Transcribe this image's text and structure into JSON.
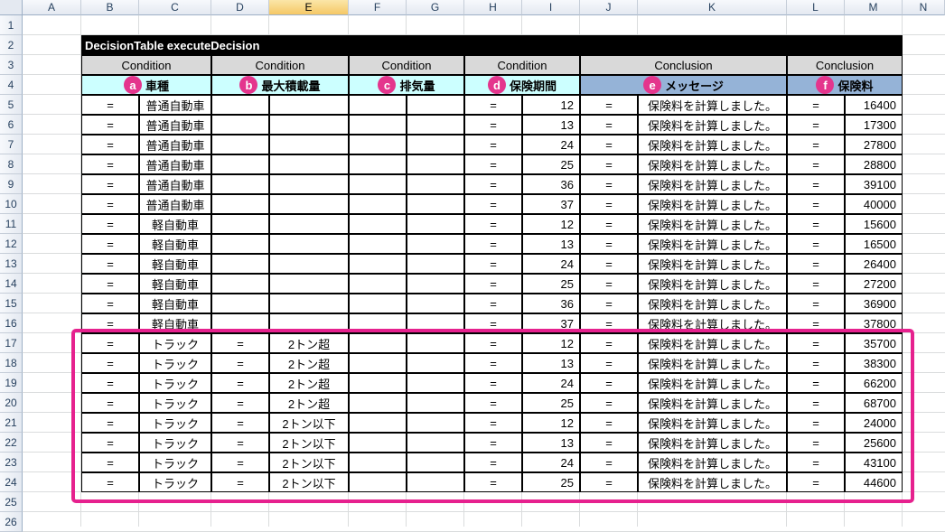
{
  "columns": [
    "A",
    "B",
    "C",
    "D",
    "E",
    "F",
    "G",
    "H",
    "I",
    "J",
    "K",
    "L",
    "M",
    "N"
  ],
  "selected_column": "E",
  "rows": [
    "1",
    "2",
    "3",
    "4",
    "5",
    "6",
    "7",
    "8",
    "9",
    "10",
    "11",
    "12",
    "13",
    "14",
    "15",
    "16",
    "17",
    "18",
    "19",
    "20",
    "21",
    "22",
    "23",
    "24",
    "25",
    "26"
  ],
  "table_title": "DecisionTable executeDecision",
  "group_headers": [
    "Condition",
    "Condition",
    "Condition",
    "Condition",
    "Conclusion",
    "Conclusion"
  ],
  "field_headers": [
    {
      "badge": "a",
      "label": "車種"
    },
    {
      "badge": "b",
      "label": "最大積載量"
    },
    {
      "badge": "c",
      "label": "排気量"
    },
    {
      "badge": "d",
      "label": "保険期間"
    },
    {
      "badge": "e",
      "label": "メッセージ"
    },
    {
      "badge": "f",
      "label": "保険料"
    }
  ],
  "data_rows": [
    [
      "=",
      "普通自動車",
      "",
      "",
      "",
      "",
      "=",
      "12",
      "=",
      "保険料を計算しました。",
      "=",
      "16400"
    ],
    [
      "=",
      "普通自動車",
      "",
      "",
      "",
      "",
      "=",
      "13",
      "=",
      "保険料を計算しました。",
      "=",
      "17300"
    ],
    [
      "=",
      "普通自動車",
      "",
      "",
      "",
      "",
      "=",
      "24",
      "=",
      "保険料を計算しました。",
      "=",
      "27800"
    ],
    [
      "=",
      "普通自動車",
      "",
      "",
      "",
      "",
      "=",
      "25",
      "=",
      "保険料を計算しました。",
      "=",
      "28800"
    ],
    [
      "=",
      "普通自動車",
      "",
      "",
      "",
      "",
      "=",
      "36",
      "=",
      "保険料を計算しました。",
      "=",
      "39100"
    ],
    [
      "=",
      "普通自動車",
      "",
      "",
      "",
      "",
      "=",
      "37",
      "=",
      "保険料を計算しました。",
      "=",
      "40000"
    ],
    [
      "=",
      "軽自動車",
      "",
      "",
      "",
      "",
      "=",
      "12",
      "=",
      "保険料を計算しました。",
      "=",
      "15600"
    ],
    [
      "=",
      "軽自動車",
      "",
      "",
      "",
      "",
      "=",
      "13",
      "=",
      "保険料を計算しました。",
      "=",
      "16500"
    ],
    [
      "=",
      "軽自動車",
      "",
      "",
      "",
      "",
      "=",
      "24",
      "=",
      "保険料を計算しました。",
      "=",
      "26400"
    ],
    [
      "=",
      "軽自動車",
      "",
      "",
      "",
      "",
      "=",
      "25",
      "=",
      "保険料を計算しました。",
      "=",
      "27200"
    ],
    [
      "=",
      "軽自動車",
      "",
      "",
      "",
      "",
      "=",
      "36",
      "=",
      "保険料を計算しました。",
      "=",
      "36900"
    ],
    [
      "=",
      "軽自動車",
      "",
      "",
      "",
      "",
      "=",
      "37",
      "=",
      "保険料を計算しました。",
      "=",
      "37800"
    ],
    [
      "=",
      "トラック",
      "=",
      "2トン超",
      "",
      "",
      "=",
      "12",
      "=",
      "保険料を計算しました。",
      "=",
      "35700"
    ],
    [
      "=",
      "トラック",
      "=",
      "2トン超",
      "",
      "",
      "=",
      "13",
      "=",
      "保険料を計算しました。",
      "=",
      "38300"
    ],
    [
      "=",
      "トラック",
      "=",
      "2トン超",
      "",
      "",
      "=",
      "24",
      "=",
      "保険料を計算しました。",
      "=",
      "66200"
    ],
    [
      "=",
      "トラック",
      "=",
      "2トン超",
      "",
      "",
      "=",
      "25",
      "=",
      "保険料を計算しました。",
      "=",
      "68700"
    ],
    [
      "=",
      "トラック",
      "=",
      "2トン以下",
      "",
      "",
      "=",
      "12",
      "=",
      "保険料を計算しました。",
      "=",
      "24000"
    ],
    [
      "=",
      "トラック",
      "=",
      "2トン以下",
      "",
      "",
      "=",
      "13",
      "=",
      "保険料を計算しました。",
      "=",
      "25600"
    ],
    [
      "=",
      "トラック",
      "=",
      "2トン以下",
      "",
      "",
      "=",
      "24",
      "=",
      "保険料を計算しました。",
      "=",
      "43100"
    ],
    [
      "=",
      "トラック",
      "=",
      "2トン以下",
      "",
      "",
      "=",
      "25",
      "=",
      "保険料を計算しました。",
      "=",
      "44600"
    ]
  ],
  "highlight_color": "#e6218e"
}
